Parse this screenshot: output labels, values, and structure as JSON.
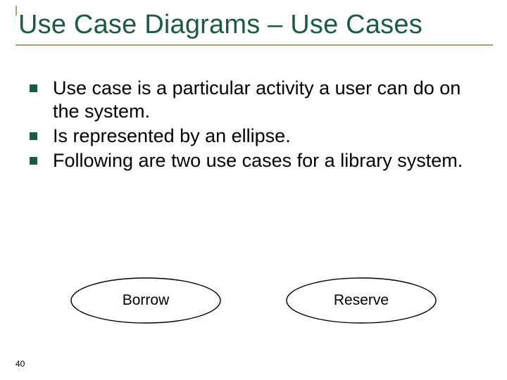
{
  "title": "Use Case Diagrams – Use Cases",
  "bullets": [
    "Use case is a particular activity a user can do on the system.",
    "Is represented by an ellipse.",
    "Following are two use cases for a library system."
  ],
  "usecases": {
    "left": "Borrow",
    "right": "Reserve"
  },
  "pageNumber": "40"
}
